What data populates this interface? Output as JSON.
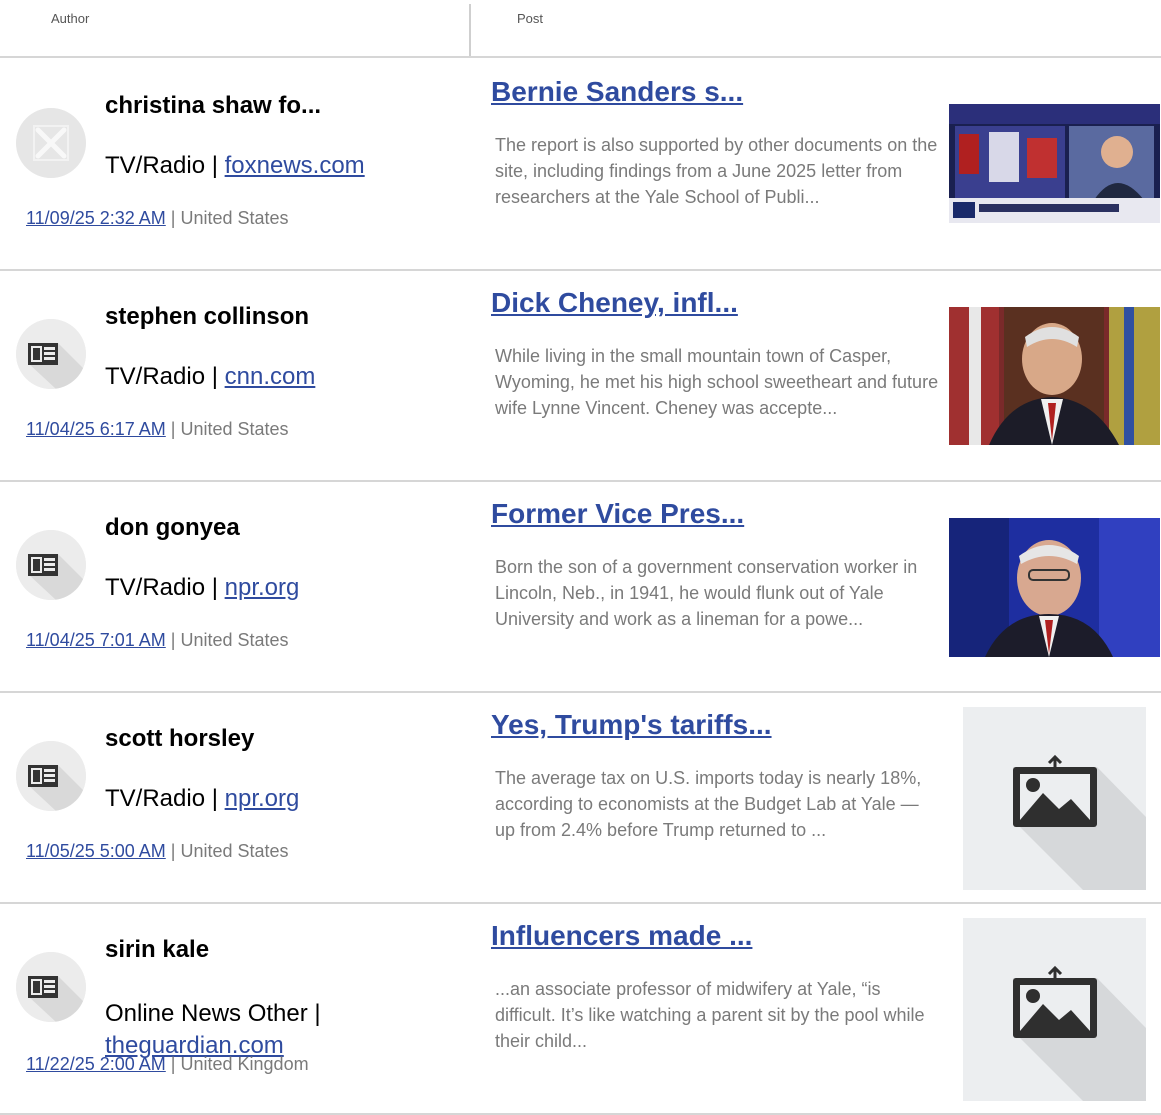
{
  "header": {
    "author_label": "Author",
    "post_label": "Post"
  },
  "rows": [
    {
      "author_name": "christina shaw fo...",
      "media_type": "TV/Radio",
      "separator": "|",
      "domain": "foxnews.com",
      "date": "11/09/25 2:32 AM",
      "country": "United States",
      "avatar_icon": "broken-avatar-icon",
      "post_title": "Bernie Sanders s...",
      "excerpt": "The report is also supported by other documents on the site, including findings from a June 2025 letter from researchers at the Yale School of Publi...",
      "thumb_icon": "news-broadcast-thumbnail"
    },
    {
      "author_name": "stephen collinson",
      "media_type": "TV/Radio",
      "separator": "|",
      "domain": "cnn.com",
      "date": "11/04/25 6:17 AM",
      "country": "United States",
      "avatar_icon": "newspaper-icon",
      "post_title": "Dick Cheney, infl...",
      "excerpt": "While living in the small mountain town of Casper, Wyoming, he met his high school sweetheart and future wife Lynne Vincent. Cheney was accepte...",
      "thumb_icon": "portrait-photo-thumbnail"
    },
    {
      "author_name": "don gonyea",
      "media_type": "TV/Radio",
      "separator": "|",
      "domain": "npr.org",
      "date": "11/04/25 7:01 AM",
      "country": "United States",
      "avatar_icon": "newspaper-icon",
      "post_title": "Former Vice Pres...",
      "excerpt": "Born the son of a government conservation worker in Lincoln, Neb., in 1941, he would flunk out of Yale University and work as a lineman for a powe...",
      "thumb_icon": "portrait-photo-thumbnail"
    },
    {
      "author_name": "scott horsley",
      "media_type": "TV/Radio",
      "separator": "|",
      "domain": "npr.org",
      "date": "11/05/25 5:00 AM",
      "country": "United States",
      "avatar_icon": "newspaper-icon",
      "post_title": "Yes, Trump's tariffs...",
      "excerpt": "The average tax on U.S. imports today is nearly 18%, according to economists at the Budget Lab at Yale — up from 2.4% before Trump returned to ...",
      "thumb_icon": "image-placeholder-icon"
    },
    {
      "author_name": "sirin kale",
      "media_type": "Online News Other",
      "separator": "|",
      "domain": "theguardian.com",
      "date": "11/22/25 2:00 AM",
      "country": "United Kingdom",
      "avatar_icon": "newspaper-icon",
      "post_title": "Influencers made ...",
      "excerpt": "...an associate professor of midwifery at Yale, “is difficult. It’s like watching a parent sit by the pool while their child...",
      "thumb_icon": "image-placeholder-icon"
    }
  ]
}
